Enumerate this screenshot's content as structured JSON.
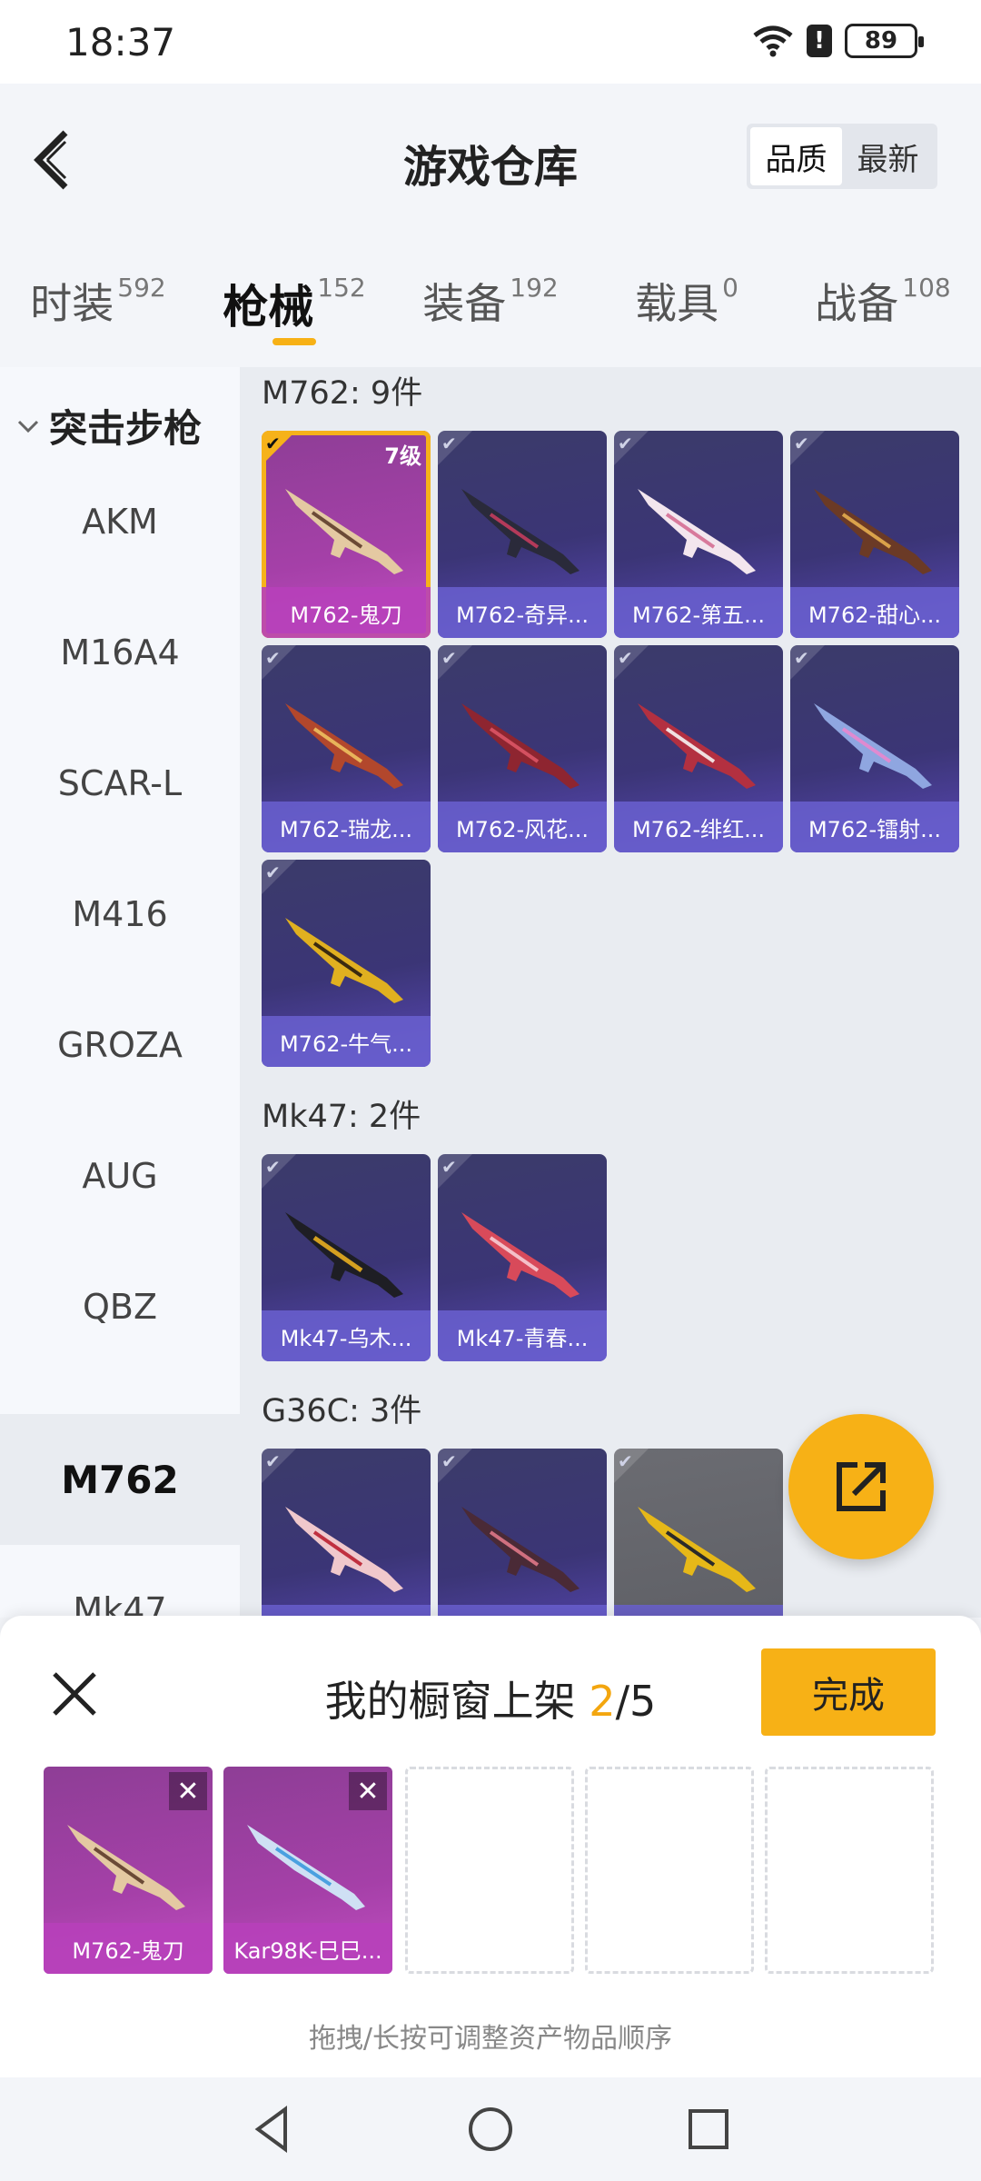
{
  "status_bar": {
    "time": "18:37",
    "battery": "89",
    "alert": "!"
  },
  "header": {
    "title": "游戏仓库",
    "sort_options": [
      "品质",
      "最新"
    ]
  },
  "tabs": [
    {
      "label": "时装",
      "count": "592"
    },
    {
      "label": "枪械",
      "count": "152"
    },
    {
      "label": "装备",
      "count": "192"
    },
    {
      "label": "载具",
      "count": "0"
    },
    {
      "label": "战备",
      "count": "108"
    }
  ],
  "sidebar": {
    "category": "突击步枪",
    "items": [
      "AKM",
      "M16A4",
      "SCAR-L",
      "M416",
      "GROZA",
      "AUG",
      "QBZ",
      "M762",
      "Mk47"
    ]
  },
  "groups": [
    {
      "title": "M762: 9件",
      "items": [
        {
          "label": "M762-鬼刀",
          "level": "7级"
        },
        {
          "label": "M762-奇异..."
        },
        {
          "label": "M762-第五..."
        },
        {
          "label": "M762-甜心..."
        },
        {
          "label": "M762-瑞龙..."
        },
        {
          "label": "M762-风花..."
        },
        {
          "label": "M762-绯红..."
        },
        {
          "label": "M762-镭射..."
        },
        {
          "label": "M762-牛气..."
        }
      ]
    },
    {
      "title": "Mk47: 2件",
      "items": [
        {
          "label": "Mk47-乌木..."
        },
        {
          "label": "Mk47-青春..."
        }
      ]
    },
    {
      "title": "G36C: 3件",
      "items": [
        {
          "label": ""
        },
        {
          "label": ""
        },
        {
          "label": ""
        }
      ]
    }
  ],
  "showcase": {
    "title": "我的橱窗上架",
    "current": "2",
    "total": "/5",
    "done_label": "完成",
    "slots": [
      "M762-鬼刀",
      "Kar98K-巳巳..."
    ],
    "hint": "拖拽/长按可调整资产物品顺序"
  },
  "colors": {
    "accent": "#f7b116",
    "card_purple": "#3b3576",
    "card_legendary": "#a540a8"
  }
}
